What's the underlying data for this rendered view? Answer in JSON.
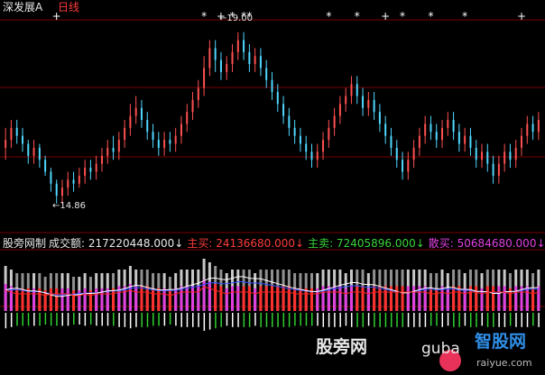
{
  "header": {
    "stock_name": "深发展A",
    "period": "日线"
  },
  "indicator": {
    "name": "股旁网制",
    "items": [
      {
        "label": "成交额:",
        "value": "217220448.000↓",
        "color": "#e8e8e8"
      },
      {
        "label": "主买:",
        "value": "24136680.000↓",
        "color": "#ff3b3b"
      },
      {
        "label": "主卖:",
        "value": "72405896.000↓",
        "color": "#3bd23b"
      },
      {
        "label": "散买:",
        "value": "50684680.000↓",
        "color": "#e040e0"
      },
      {
        "label": "散卖:",
        "value": "",
        "color": "#e8e8e8"
      }
    ]
  },
  "watermark": {
    "text1": "股旁网",
    "text2": "guba",
    "text3": "智股网",
    "text4": "raiyue.com"
  },
  "colors": {
    "up": "#ff5050",
    "down": "#50d8ff",
    "grid": "#7a0000",
    "ma_white": "#ffffff",
    "ma_blue": "#3050ff",
    "ma_red": "#ff2020",
    "vol_pos": "#e040e0",
    "vol_neg": "#30d030"
  },
  "chart_data": {
    "type": "candlestick+volume",
    "high_label": "19.00",
    "low_label": "14.86",
    "price_range": [
      14.4,
      19.6
    ],
    "candles": [
      [
        16.3,
        16.5,
        16.8,
        16.0
      ],
      [
        16.5,
        16.8,
        17.0,
        16.3
      ],
      [
        16.8,
        16.6,
        17.0,
        16.4
      ],
      [
        16.6,
        16.4,
        16.8,
        16.2
      ],
      [
        16.4,
        16.1,
        16.5,
        15.9
      ],
      [
        16.1,
        16.3,
        16.5,
        15.9
      ],
      [
        16.3,
        16.0,
        16.4,
        15.8
      ],
      [
        16.0,
        15.7,
        16.1,
        15.6
      ],
      [
        15.7,
        15.4,
        15.8,
        15.2
      ],
      [
        15.4,
        15.1,
        15.5,
        14.9
      ],
      [
        15.1,
        15.3,
        15.5,
        14.9
      ],
      [
        15.3,
        15.5,
        15.7,
        15.1
      ],
      [
        15.5,
        15.4,
        15.7,
        15.2
      ],
      [
        15.4,
        15.6,
        15.8,
        15.3
      ],
      [
        15.6,
        15.8,
        16.0,
        15.4
      ],
      [
        15.8,
        15.7,
        16.0,
        15.5
      ],
      [
        15.7,
        15.9,
        16.1,
        15.5
      ],
      [
        15.9,
        16.1,
        16.3,
        15.7
      ],
      [
        16.1,
        16.3,
        16.5,
        15.9
      ],
      [
        16.3,
        16.2,
        16.6,
        16.0
      ],
      [
        16.2,
        16.5,
        16.7,
        16.0
      ],
      [
        16.5,
        16.8,
        17.0,
        16.3
      ],
      [
        16.8,
        17.1,
        17.4,
        16.6
      ],
      [
        17.1,
        17.3,
        17.6,
        16.9
      ],
      [
        17.3,
        17.0,
        17.5,
        16.8
      ],
      [
        17.0,
        16.7,
        17.2,
        16.5
      ],
      [
        16.7,
        16.5,
        16.9,
        16.3
      ],
      [
        16.5,
        16.3,
        16.7,
        16.1
      ],
      [
        16.3,
        16.5,
        16.7,
        16.1
      ],
      [
        16.5,
        16.4,
        16.7,
        16.2
      ],
      [
        16.4,
        16.6,
        16.8,
        16.2
      ],
      [
        16.6,
        16.9,
        17.1,
        16.4
      ],
      [
        16.9,
        17.2,
        17.4,
        16.7
      ],
      [
        17.2,
        17.5,
        17.7,
        17.0
      ],
      [
        17.5,
        17.8,
        18.0,
        17.3
      ],
      [
        17.8,
        18.3,
        18.6,
        17.6
      ],
      [
        18.3,
        18.8,
        19.0,
        18.1
      ],
      [
        18.8,
        18.5,
        19.0,
        18.2
      ],
      [
        18.5,
        18.2,
        18.7,
        18.0
      ],
      [
        18.2,
        18.4,
        18.6,
        18.0
      ],
      [
        18.4,
        18.7,
        18.9,
        18.2
      ],
      [
        18.7,
        19.0,
        19.2,
        18.5
      ],
      [
        19.0,
        18.7,
        19.2,
        18.5
      ],
      [
        18.7,
        18.4,
        18.9,
        18.2
      ],
      [
        18.4,
        18.6,
        18.8,
        18.2
      ],
      [
        18.6,
        18.3,
        18.8,
        18.1
      ],
      [
        18.3,
        18.0,
        18.5,
        17.8
      ],
      [
        18.0,
        17.7,
        18.2,
        17.5
      ],
      [
        17.7,
        17.4,
        17.9,
        17.2
      ],
      [
        17.4,
        17.1,
        17.6,
        16.9
      ],
      [
        17.1,
        16.8,
        17.3,
        16.6
      ],
      [
        16.8,
        16.6,
        17.0,
        16.4
      ],
      [
        16.6,
        16.4,
        16.8,
        16.2
      ],
      [
        16.4,
        16.2,
        16.6,
        16.0
      ],
      [
        16.2,
        16.0,
        16.4,
        15.8
      ],
      [
        16.0,
        16.2,
        16.4,
        15.8
      ],
      [
        16.2,
        16.5,
        16.7,
        16.0
      ],
      [
        16.5,
        16.8,
        17.0,
        16.3
      ],
      [
        16.8,
        17.1,
        17.3,
        16.6
      ],
      [
        17.1,
        17.4,
        17.6,
        16.9
      ],
      [
        17.4,
        17.6,
        17.8,
        17.2
      ],
      [
        17.6,
        17.9,
        18.1,
        17.4
      ],
      [
        17.9,
        17.6,
        18.1,
        17.4
      ],
      [
        17.6,
        17.3,
        17.8,
        17.1
      ],
      [
        17.3,
        17.5,
        17.7,
        17.1
      ],
      [
        17.5,
        17.2,
        17.7,
        17.0
      ],
      [
        17.2,
        16.9,
        17.4,
        16.7
      ],
      [
        16.9,
        16.6,
        17.1,
        16.4
      ],
      [
        16.6,
        16.3,
        16.8,
        16.1
      ],
      [
        16.3,
        16.0,
        16.5,
        15.8
      ],
      [
        16.0,
        15.7,
        16.2,
        15.5
      ],
      [
        15.7,
        16.0,
        16.2,
        15.5
      ],
      [
        16.0,
        16.3,
        16.5,
        15.8
      ],
      [
        16.3,
        16.6,
        16.8,
        16.1
      ],
      [
        16.6,
        16.9,
        17.1,
        16.4
      ],
      [
        16.9,
        16.7,
        17.1,
        16.5
      ],
      [
        16.7,
        16.5,
        16.9,
        16.3
      ],
      [
        16.5,
        16.8,
        17.0,
        16.3
      ],
      [
        16.8,
        17.0,
        17.2,
        16.6
      ],
      [
        17.0,
        16.7,
        17.2,
        16.5
      ],
      [
        16.7,
        16.4,
        16.9,
        16.2
      ],
      [
        16.4,
        16.6,
        16.8,
        16.2
      ],
      [
        16.6,
        16.3,
        16.8,
        16.1
      ],
      [
        16.3,
        16.0,
        16.5,
        15.8
      ],
      [
        16.0,
        16.2,
        16.4,
        15.8
      ],
      [
        16.2,
        15.9,
        16.4,
        15.7
      ],
      [
        15.9,
        15.6,
        16.1,
        15.4
      ],
      [
        15.6,
        15.9,
        16.1,
        15.4
      ],
      [
        15.9,
        16.2,
        16.4,
        15.7
      ],
      [
        16.2,
        16.0,
        16.4,
        15.8
      ],
      [
        16.0,
        16.3,
        16.5,
        15.8
      ],
      [
        16.3,
        16.6,
        16.8,
        16.1
      ],
      [
        16.6,
        16.9,
        17.1,
        16.4
      ],
      [
        16.9,
        16.7,
        17.1,
        16.5
      ],
      [
        16.7,
        17.0,
        17.2,
        16.5
      ]
    ],
    "signal_markers": [
      {
        "index": 9,
        "symbol": "+"
      },
      {
        "index": 35,
        "symbol": "*"
      },
      {
        "index": 38,
        "symbol": "+"
      },
      {
        "index": 40,
        "symbol": "*"
      },
      {
        "index": 42,
        "symbol": "*"
      },
      {
        "index": 43,
        "symbol": "*"
      },
      {
        "index": 57,
        "symbol": "*"
      },
      {
        "index": 62,
        "symbol": "*"
      },
      {
        "index": 67,
        "symbol": "+"
      },
      {
        "index": 70,
        "symbol": "*"
      },
      {
        "index": 75,
        "symbol": "*"
      },
      {
        "index": 81,
        "symbol": "*"
      },
      {
        "index": 91,
        "symbol": "+"
      }
    ]
  }
}
